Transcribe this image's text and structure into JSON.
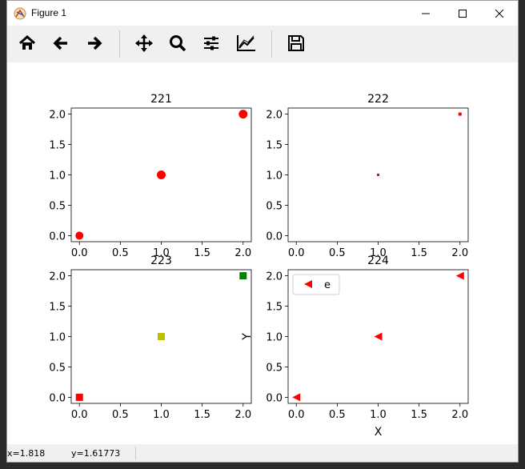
{
  "window": {
    "title": "Figure 1"
  },
  "toolbar": {
    "buttons": [
      "home-icon",
      "back-icon",
      "forward-icon",
      "pan-icon",
      "zoom-icon",
      "subplots-icon",
      "customize-icon",
      "save-icon"
    ]
  },
  "status": {
    "x_label": "x=1.818",
    "y_label": "y=1.61773"
  },
  "chart_data": [
    {
      "type": "scatter",
      "title": "221",
      "x": [
        0,
        1,
        2
      ],
      "y": [
        0,
        1,
        2
      ],
      "marker": "circle",
      "sizes": [
        8,
        9,
        9
      ],
      "colors": [
        "#ff0000",
        "#ff0000",
        "#ff0000"
      ],
      "xlim": [
        -0.1,
        2.1
      ],
      "ylim": [
        -0.1,
        2.1
      ],
      "xticks": [
        "0.0",
        "0.5",
        "1.0",
        "1.5",
        "2.0"
      ],
      "yticks": [
        "0.0",
        "0.5",
        "1.0",
        "1.5",
        "2.0"
      ],
      "xlabel": "",
      "ylabel": "",
      "legend": null
    },
    {
      "type": "scatter",
      "title": "222",
      "x": [
        1,
        2
      ],
      "y": [
        1,
        2
      ],
      "marker": "square",
      "sizes": [
        3,
        4
      ],
      "colors": [
        "#ff0000",
        "#ff0000"
      ],
      "xlim": [
        -0.1,
        2.1
      ],
      "ylim": [
        -0.1,
        2.1
      ],
      "xticks": [
        "0.0",
        "0.5",
        "1.0",
        "1.5",
        "2.0"
      ],
      "yticks": [
        "0.0",
        "0.5",
        "1.0",
        "1.5",
        "2.0"
      ],
      "xlabel": "",
      "ylabel": "",
      "legend": null
    },
    {
      "type": "scatter",
      "title": "223",
      "x": [
        0,
        1,
        2
      ],
      "y": [
        0,
        1,
        2
      ],
      "marker": "square",
      "sizes": [
        9,
        9,
        9
      ],
      "colors": [
        "#ff0000",
        "#bfbf00",
        "#008000"
      ],
      "xlim": [
        -0.1,
        2.1
      ],
      "ylim": [
        -0.1,
        2.1
      ],
      "xticks": [
        "0.0",
        "0.5",
        "1.0",
        "1.5",
        "2.0"
      ],
      "yticks": [
        "0.0",
        "0.5",
        "1.0",
        "1.5",
        "2.0"
      ],
      "xlabel": "",
      "ylabel": "",
      "legend": null
    },
    {
      "type": "scatter",
      "title": "224",
      "x": [
        0,
        1,
        2
      ],
      "y": [
        0,
        1,
        2
      ],
      "marker": "triangle-left",
      "sizes": [
        10,
        10,
        10
      ],
      "colors": [
        "#ff0000",
        "#ff0000",
        "#ff0000"
      ],
      "xlim": [
        -0.1,
        2.1
      ],
      "ylim": [
        -0.1,
        2.1
      ],
      "xticks": [
        "0.0",
        "0.5",
        "1.0",
        "1.5",
        "2.0"
      ],
      "yticks": [
        "0.0",
        "0.5",
        "1.0",
        "1.5",
        "2.0"
      ],
      "xlabel": "X",
      "ylabel": "Y",
      "legend": "e"
    }
  ]
}
